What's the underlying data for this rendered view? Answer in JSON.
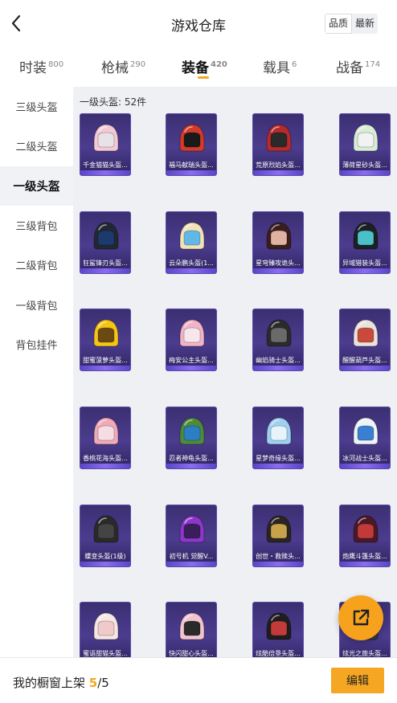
{
  "header": {
    "title": "游戏仓库",
    "sort": [
      "品质",
      "最新"
    ],
    "sort_selected": "品质"
  },
  "tabs": [
    {
      "label": "时装",
      "count": "800"
    },
    {
      "label": "枪械",
      "count": "290"
    },
    {
      "label": "装备",
      "count": "420",
      "active": true
    },
    {
      "label": "载具",
      "count": "6"
    },
    {
      "label": "战备",
      "count": "174"
    }
  ],
  "sidebar": {
    "items": [
      {
        "label": "三级头盔"
      },
      {
        "label": "二级头盔"
      },
      {
        "label": "一级头盔",
        "active": true
      },
      {
        "label": "三级背包"
      },
      {
        "label": "二级背包"
      },
      {
        "label": "一级背包"
      },
      {
        "label": "背包挂件"
      }
    ]
  },
  "content": {
    "section_title": "一级头盔: 52件",
    "items": [
      {
        "name": "千金猫猫头盔...",
        "color": "#f3c9d6",
        "visor": "#e8e2e6"
      },
      {
        "name": "福马献瑞头盔...",
        "color": "#d23a2a",
        "visor": "#1a1a1a"
      },
      {
        "name": "荒原烈焰头盔...",
        "color": "#b52a2a",
        "visor": "#2a2a2a"
      },
      {
        "name": "薄荷星砂头盔...",
        "color": "#d8ecd6",
        "visor": "#f2f2f2"
      },
      {
        "name": "狂鲨锋刃头盔...",
        "color": "#222831",
        "visor": "#1c3a6e"
      },
      {
        "name": "云朵鹏头盔(1...",
        "color": "#f3e2b7",
        "visor": "#5fb8e8"
      },
      {
        "name": "星穹臻攻诡头...",
        "color": "#3a1e1e",
        "visor": "#e0b2a0"
      },
      {
        "name": "异域猎装头盔...",
        "color": "#1c1f24",
        "visor": "#4bc1c7"
      },
      {
        "name": "甜蜜菠萝头盔...",
        "color": "#f5c516",
        "visor": "#6b4a12"
      },
      {
        "name": "梅安公主头盔...",
        "color": "#f1b4c6",
        "visor": "#f7e6ec"
      },
      {
        "name": "幽焰骑士头盔...",
        "color": "#2b2b2b",
        "visor": "#6a6a6a"
      },
      {
        "name": "醒醒葫芦头盔...",
        "color": "#e9e1dc",
        "visor": "#c94a3b"
      },
      {
        "name": "香桃花海头盔...",
        "color": "#f0a9b8",
        "visor": "#f6dde4"
      },
      {
        "name": "忍者神龟头盔...",
        "color": "#4e8a3b",
        "visor": "#2b7ec2"
      },
      {
        "name": "星梦奇缘头盔...",
        "color": "#9fd0f0",
        "visor": "#e7f4fb"
      },
      {
        "name": "冰河战士头盔...",
        "color": "#eef3f8",
        "visor": "#3a7fd0"
      },
      {
        "name": "蝶变头盔(1级)",
        "color": "#2a2a2a",
        "visor": "#444444"
      },
      {
        "name": "初号机 觉醒V...",
        "color": "#8c37c9",
        "visor": "#3a1e5a"
      },
      {
        "name": "创世・救赎头...",
        "color": "#2a2422",
        "visor": "#c8a24a"
      },
      {
        "name": "炮鹰斗篷头盔...",
        "color": "#4a1826",
        "visor": "#c03a3a"
      },
      {
        "name": "蜜语甜猫头盔...",
        "color": "#f7e7e4",
        "visor": "#f0c9c9"
      },
      {
        "name": "快闪甜心头盔...",
        "color": "#f1c4cf",
        "visor": "#2a2a2a"
      },
      {
        "name": "炫酷倍垦头盔...",
        "color": "#1e1e1e",
        "visor": "#c23a3a"
      },
      {
        "name": "炫光之旅头盔...",
        "color": "#3a3a44",
        "visor": "#7fa7d8"
      }
    ]
  },
  "bottom": {
    "label": "我的橱窗上架",
    "current": "5",
    "sep": "/",
    "total": "5",
    "edit": "编辑"
  }
}
